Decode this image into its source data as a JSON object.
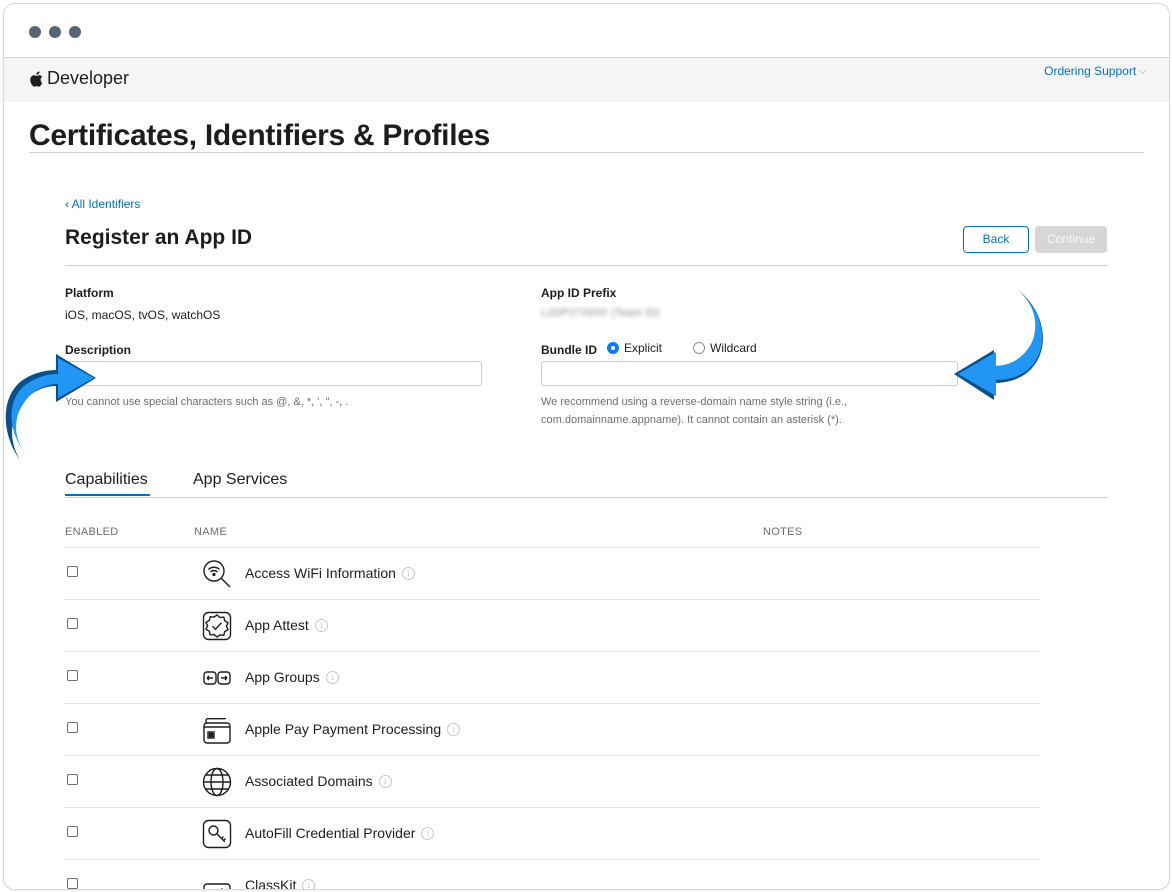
{
  "brand": {
    "name": "Developer"
  },
  "nav": {
    "ordering_support": "Ordering Support"
  },
  "page": {
    "title": "Certificates, Identifiers & Profiles"
  },
  "form": {
    "back_link": "‹ All Identifiers",
    "title": "Register an App ID",
    "back_button": "Back",
    "continue_button": "Continue",
    "platform_label": "Platform",
    "platform_value": "iOS, macOS, tvOS, watchOS",
    "prefix_label": "App ID Prefix",
    "prefix_value": "L2DP27X6XF (Team ID)",
    "description_label": "Description",
    "description_value": "",
    "description_help": "You cannot use special characters such as @, &, *, ', \", -, .",
    "bundle_label": "Bundle ID",
    "bundle_options": [
      {
        "label": "Explicit",
        "selected": true
      },
      {
        "label": "Wildcard",
        "selected": false
      }
    ],
    "bundle_value": "",
    "bundle_help_1": "We recommend using a reverse-domain name style string (i.e.,",
    "bundle_help_2": "com.domainname.appname). It cannot contain an asterisk (*)."
  },
  "tabs": [
    {
      "label": "Capabilities",
      "active": true
    },
    {
      "label": "App Services",
      "active": false
    }
  ],
  "table": {
    "columns": [
      "ENABLED",
      "NAME",
      "NOTES"
    ],
    "rows": [
      {
        "name": "Access WiFi Information",
        "icon": "wifi-search-icon",
        "enabled": false
      },
      {
        "name": "App Attest",
        "icon": "badge-check-icon",
        "enabled": false
      },
      {
        "name": "App Groups",
        "icon": "app-groups-icon",
        "enabled": false
      },
      {
        "name": "Apple Pay Payment Processing",
        "icon": "card-icon",
        "enabled": false
      },
      {
        "name": "Associated Domains",
        "icon": "globe-icon",
        "enabled": false
      },
      {
        "name": "AutoFill Credential Provider",
        "icon": "key-icon",
        "enabled": false
      },
      {
        "name": "ClassKit",
        "icon": "classkit-icon",
        "enabled": false
      }
    ]
  },
  "colors": {
    "accent": "#0070c9",
    "annotation_arrow": "#2196f3",
    "annotation_arrow_shadow": "#0b4f8a"
  }
}
